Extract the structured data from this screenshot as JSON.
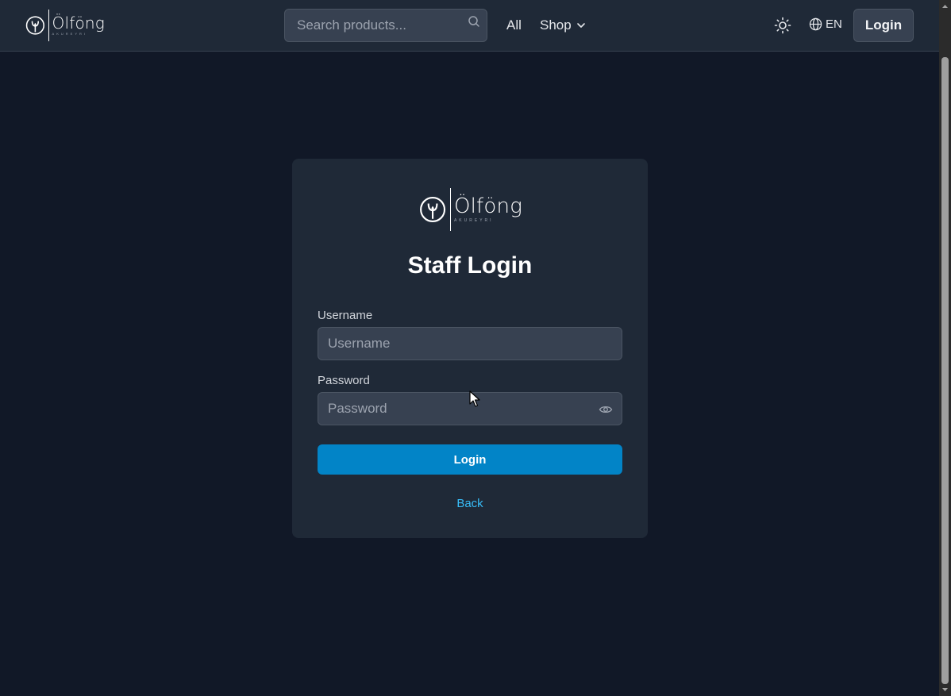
{
  "header": {
    "logo": {
      "brand": "Ölföng",
      "subtitle": "AKUREYRI"
    },
    "search": {
      "placeholder": "Search products...",
      "value": ""
    },
    "nav": {
      "all_label": "All",
      "shop_label": "Shop"
    },
    "language": "EN",
    "login_label": "Login"
  },
  "card": {
    "logo": {
      "brand": "Ölföng",
      "subtitle": "AKUREYRI"
    },
    "title": "Staff Login",
    "username": {
      "label": "Username",
      "placeholder": "Username",
      "value": ""
    },
    "password": {
      "label": "Password",
      "placeholder": "Password",
      "value": ""
    },
    "submit_label": "Login",
    "back_label": "Back"
  },
  "colors": {
    "background": "#111827",
    "surface": "#1f2937",
    "input": "#374151",
    "accent": "#0284c7",
    "link": "#38bdf8"
  }
}
